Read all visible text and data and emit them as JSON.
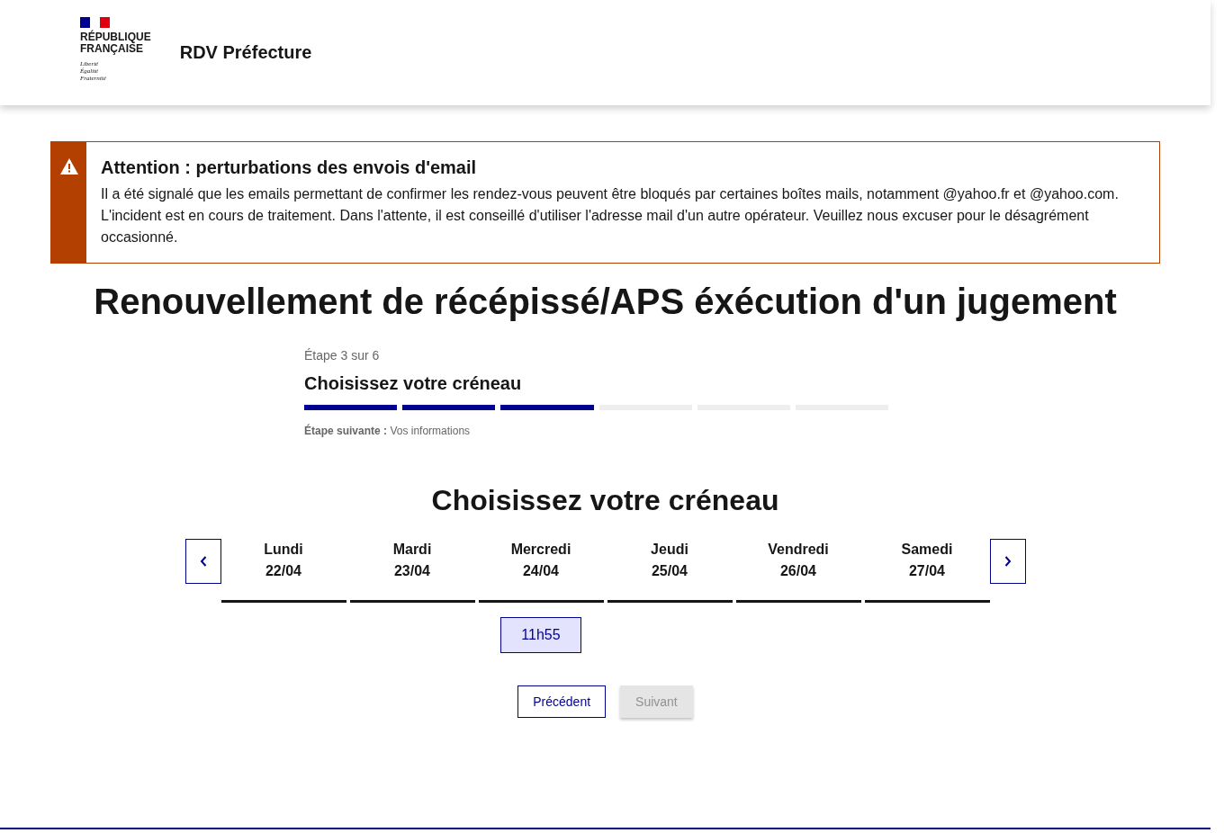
{
  "header": {
    "brand_lines": [
      "RÉPUBLIQUE",
      "FRANÇAISE"
    ],
    "motto": [
      "Liberté",
      "Égalité",
      "Fraternité"
    ],
    "service": "RDV Préfecture"
  },
  "alert": {
    "title": "Attention : perturbations des envois d'email",
    "text": "Il a été signalé que les emails permettant de confirmer les rendez-vous peuvent être bloqués par certaines boîtes mails, notamment @yahoo.fr et @yahoo.com. L'incident est en cours de traitement. Dans l'attente, il est conseillé d'utiliser l'adresse mail d'un autre opérateur. Veuillez nous excuser pour le désagrément occasionné."
  },
  "page_title": "Renouvellement de récépissé/APS éxécution d'un jugement",
  "stepper": {
    "step_label": "Étape 3 sur 6",
    "title": "Choisissez votre créneau",
    "segments": [
      {
        "completed": true
      },
      {
        "completed": true
      },
      {
        "completed": true
      },
      {
        "completed": false
      },
      {
        "completed": false
      },
      {
        "completed": false
      }
    ],
    "next_label": "Étape suivante :",
    "next_value": "Vos informations"
  },
  "slot_picker": {
    "title": "Choisissez votre créneau",
    "days": [
      {
        "day": "Lundi",
        "date": "22/04"
      },
      {
        "day": "Mardi",
        "date": "23/04"
      },
      {
        "day": "Mercredi",
        "date": "24/04",
        "times": [
          "11h55"
        ]
      },
      {
        "day": "Jeudi",
        "date": "25/04"
      },
      {
        "day": "Vendredi",
        "date": "26/04"
      },
      {
        "day": "Samedi",
        "date": "27/04"
      }
    ]
  },
  "buttons": [
    {
      "label": "Précédent",
      "disabled": false
    },
    {
      "label": "Suivant",
      "disabled": true
    }
  ]
}
